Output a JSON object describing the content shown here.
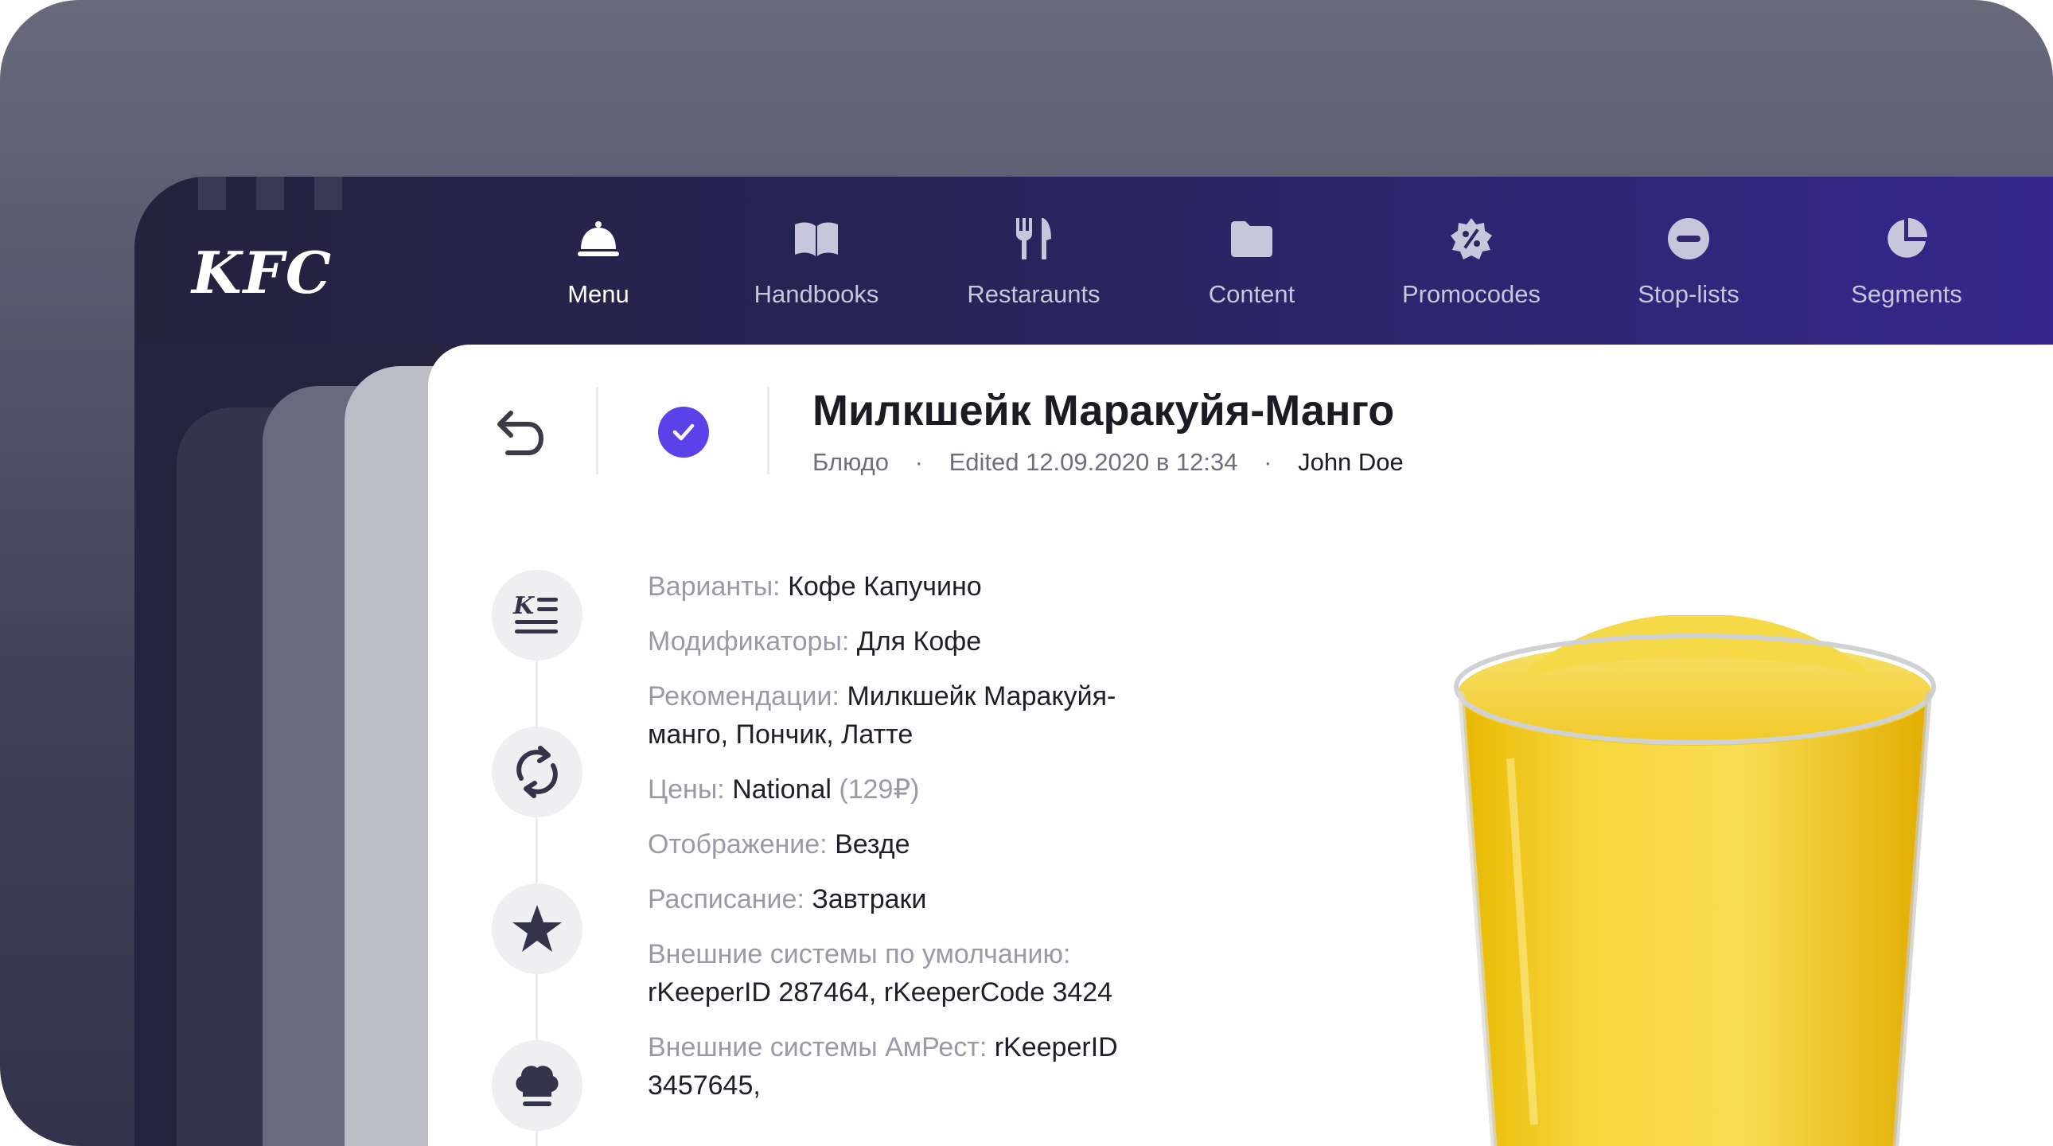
{
  "app": {
    "logo": "KFC",
    "nav": [
      {
        "label": "Menu",
        "icon": "cloche-icon",
        "active": true
      },
      {
        "label": "Handbooks",
        "icon": "book-icon",
        "active": false
      },
      {
        "label": "Restaraunts",
        "icon": "cutlery-icon",
        "active": false
      },
      {
        "label": "Content",
        "icon": "folder-icon",
        "active": false
      },
      {
        "label": "Promocodes",
        "icon": "percent-badge-icon",
        "active": false
      },
      {
        "label": "Stop-lists",
        "icon": "minus-circle-icon",
        "active": false
      },
      {
        "label": "Segments",
        "icon": "pie-chart-icon",
        "active": false
      }
    ]
  },
  "card": {
    "title": "Милкшейк Маракуйя-Манго",
    "meta": {
      "type": "Блюдо",
      "edited": "Edited 12.09.2020 в 12:34",
      "author": "John Doe",
      "separator": "·"
    },
    "side_icons": [
      "kfc-list-icon",
      "refresh-icon",
      "star-icon",
      "chef-hat-icon"
    ],
    "props": [
      {
        "key": "Варианты:",
        "value": "Кофе Капучино"
      },
      {
        "key": "Модификаторы:",
        "value": "Для Кофе"
      },
      {
        "key": "Рекомендации:",
        "value": "Милкшейк Маракуйя-манго, Пончик, Латте"
      },
      {
        "key": "Цены:",
        "value": "National",
        "extra": "(129₽)"
      },
      {
        "key": "Отображение:",
        "value": "Везде"
      },
      {
        "key": "Расписание:",
        "value": "Завтраки"
      },
      {
        "key": "Внешние системы по умолчанию:",
        "value": "rKeeperID 287464, rKeeperCode 3424"
      },
      {
        "key": "Внешние системы АмРест:",
        "value": "rKeeperID 3457645,"
      }
    ]
  },
  "colors": {
    "accent": "#5b41e8",
    "topbar_start": "#24223c",
    "topbar_end": "#37278c"
  }
}
